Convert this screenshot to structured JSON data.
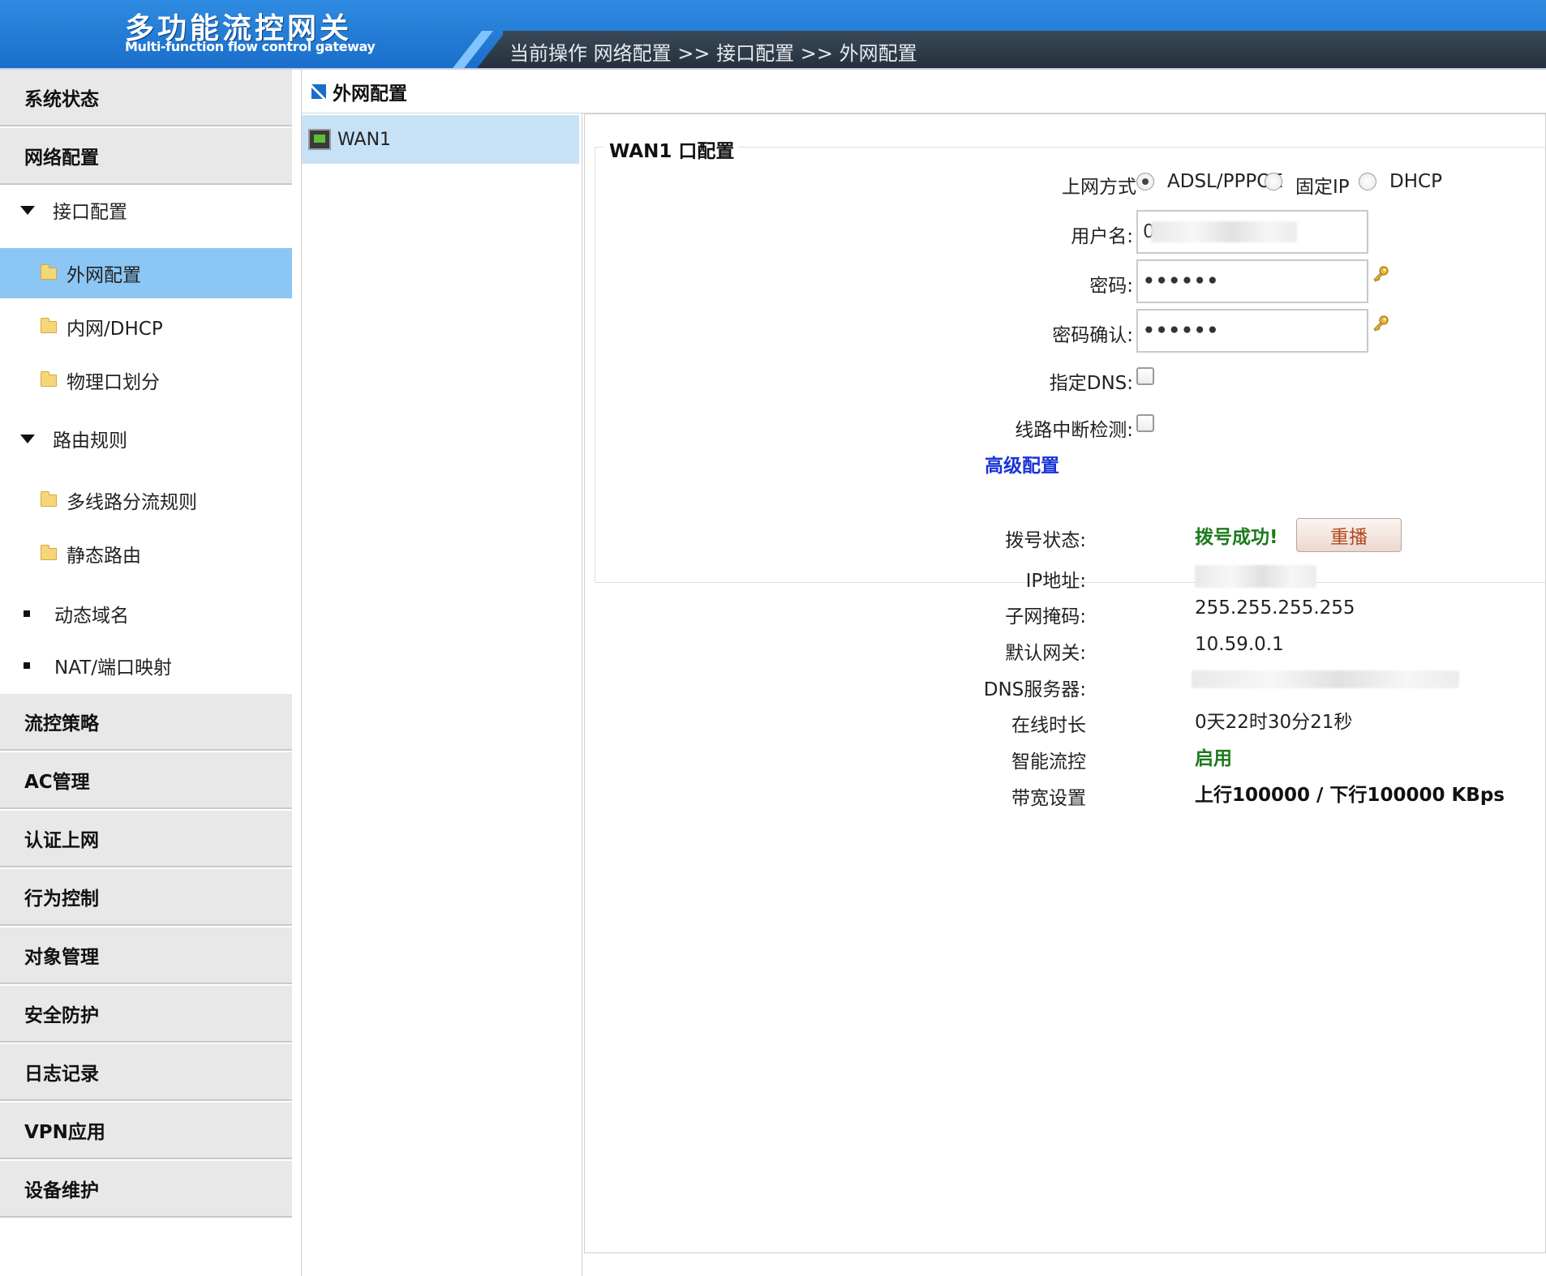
{
  "header": {
    "title": "多功能流控网关",
    "subtitle": "Multi-function flow control gateway",
    "breadcrumb": "当前操作  网络配置 >> 接口配置 >> 外网配置"
  },
  "sidebar": {
    "categories": {
      "system_status": "系统状态",
      "network_config": "网络配置",
      "flow_policy": "流控策略",
      "ac_manage": "AC管理",
      "auth_net": "认证上网",
      "behavior": "行为控制",
      "objects": "对象管理",
      "security": "安全防护",
      "logs": "日志记录",
      "vpn": "VPN应用",
      "maintenance": "设备维护"
    },
    "interface_config": "接口配置",
    "wan_config": "外网配置",
    "lan_dhcp": "内网/DHCP",
    "physical_ports": "物理口划分",
    "routing_rules": "路由规则",
    "multiline_rules": "多线路分流规则",
    "static_route": "静态路由",
    "ddns": "动态域名",
    "nat": "NAT/端口映射"
  },
  "middle": {
    "title": "外网配置",
    "wan_item": "WAN1"
  },
  "form": {
    "legend": "WAN1 口配置",
    "mode_label": "上网方式",
    "mode_options": [
      "ADSL/PPPOE",
      "固定IP",
      "DHCP"
    ],
    "mode_selected": "ADSL/PPPOE",
    "username_label": "用户名:",
    "username_value": "0",
    "password_label": "密码:",
    "password_value": "••••••",
    "confirm_label": "密码确认:",
    "confirm_value": "••••••",
    "dns_label": "指定DNS:",
    "line_check_label": "线路中断检测:",
    "advanced_link": "高级配置"
  },
  "status": {
    "dial_label": "拨号状态:",
    "dial_value": "拨号成功!",
    "redial_button": "重播",
    "ip_label": "IP地址:",
    "mask_label": "子网掩码:",
    "mask_value": "255.255.255.255",
    "gateway_label": "默认网关:",
    "gateway_value": "10.59.0.1",
    "dns_label": "DNS服务器:",
    "uptime_label": "在线时长",
    "uptime_value": "0天22时30分21秒",
    "smart_label": "智能流控",
    "smart_value": "启用",
    "bandwidth_label": "带宽设置",
    "bandwidth_value": "上行100000 / 下行100000 KBps"
  },
  "colors": {
    "header_blue": "#1f78d6",
    "header_dark": "#2b3743",
    "sidebar_active": "#8cc6f4",
    "success_green": "#1b7a1b",
    "link_blue": "#1a33d6"
  }
}
